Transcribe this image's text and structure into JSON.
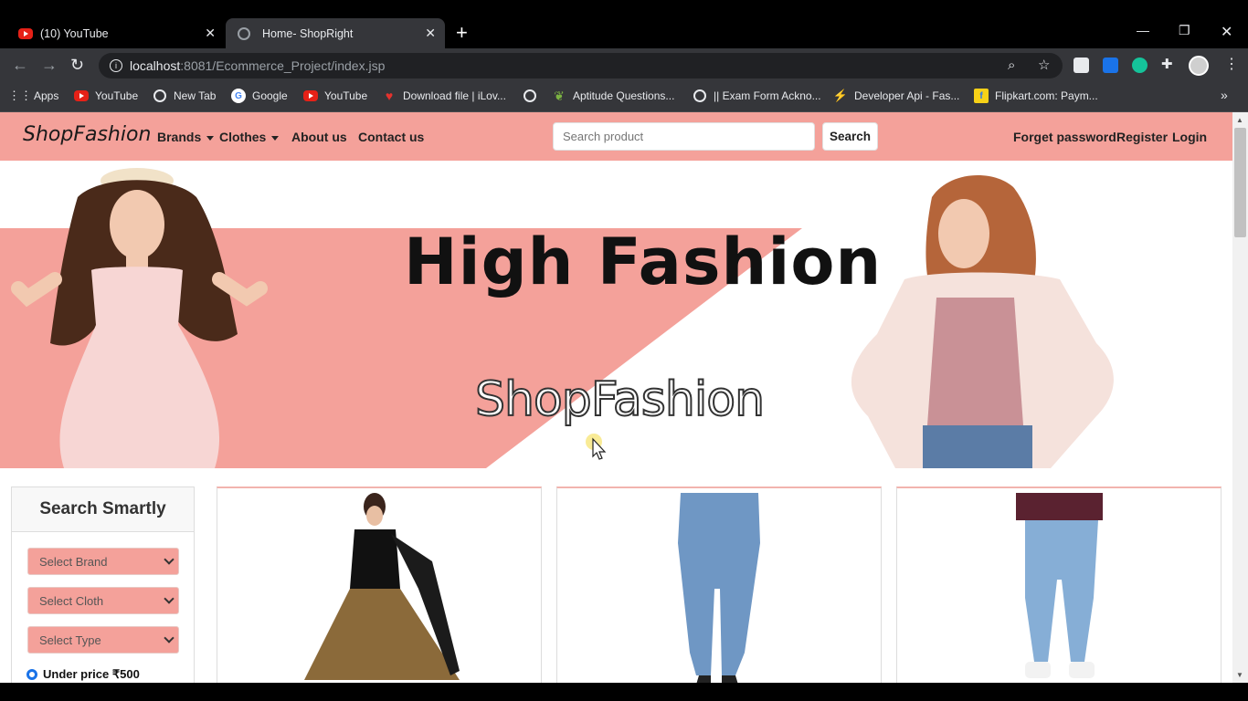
{
  "browser": {
    "tabs": [
      {
        "title": "(10) YouTube",
        "active": false
      },
      {
        "title": "Home- ShopRight",
        "active": true
      }
    ],
    "url_host": "localhost",
    "url_rest": ":8081/Ecommerce_Project/index.jsp",
    "bookmarks": [
      {
        "label": "Apps",
        "icon": "apps-grid-icon"
      },
      {
        "label": "YouTube",
        "icon": "youtube-icon"
      },
      {
        "label": "New Tab",
        "icon": "globe-icon"
      },
      {
        "label": "Google",
        "icon": "google-icon"
      },
      {
        "label": "YouTube",
        "icon": "youtube-icon"
      },
      {
        "label": "Download file | iLov...",
        "icon": "ilovepdf-icon"
      },
      {
        "label": "",
        "icon": "globe-icon"
      },
      {
        "label": "Aptitude Questions...",
        "icon": "leaf-icon"
      },
      {
        "label": "|| Exam Form Ackno...",
        "icon": "globe-icon"
      },
      {
        "label": "Developer Api - Fas...",
        "icon": "fast2sms-icon"
      },
      {
        "label": "Flipkart.com: Paym...",
        "icon": "flipkart-icon"
      }
    ]
  },
  "site": {
    "brand": "ShopFashion",
    "nav": {
      "brands": "Brands",
      "clothes": "Clothes",
      "about": "About us",
      "contact": "Contact us"
    },
    "search": {
      "placeholder": "Search product",
      "button": "Search"
    },
    "account": {
      "forget": "Forget password",
      "register": "Register",
      "login": "Login"
    },
    "hero": {
      "title": "High Fashion",
      "subtitle": "ShopFashion"
    },
    "sidebar": {
      "heading": "Search Smartly",
      "selects": [
        "Select Brand",
        "Select Cloth",
        "Select Type"
      ],
      "price_option": "Under price ₹500"
    }
  },
  "colors": {
    "accent": "#f4a19a",
    "chrome_dark": "#35363a"
  }
}
